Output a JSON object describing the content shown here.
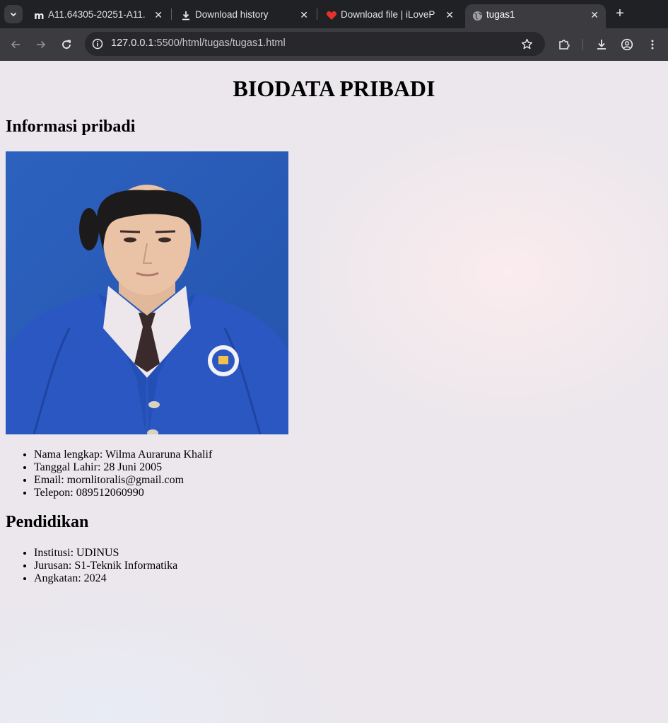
{
  "browser": {
    "tabs": [
      {
        "title": "A11.64305-20251-A11.",
        "icon": "moodle-icon",
        "active": false
      },
      {
        "title": "Download history",
        "icon": "download-icon",
        "active": false
      },
      {
        "title": "Download file | iLoveP",
        "icon": "heart-icon",
        "active": false
      },
      {
        "title": "tugas1",
        "icon": "globe-icon",
        "active": true
      }
    ],
    "close_glyph": "✕",
    "new_tab_glyph": "+",
    "url_host": "127.0.0.1",
    "url_rest": ":5500/html/tugas/tugas1.html"
  },
  "page": {
    "title": "BIODATA PRIBADI",
    "personal": {
      "heading": "Informasi pribadi",
      "items": [
        "Nama lengkap: Wilma Auraruna Khalif",
        "Tanggal Lahir: 28 Juni 2005",
        "Email: mornlitoralis@gmail.com",
        "Telepon: 089512060990"
      ]
    },
    "education": {
      "heading": "Pendidikan",
      "items": [
        "Institusi: UDINUS",
        "Jurusan: S1-Teknik Informatika",
        "Angkatan: 2024"
      ]
    }
  },
  "colors": {
    "photo_background": "#2b5fb9",
    "jacket": "#2a58c4",
    "tab_bar": "#202124",
    "toolbar": "#3c3c40"
  }
}
